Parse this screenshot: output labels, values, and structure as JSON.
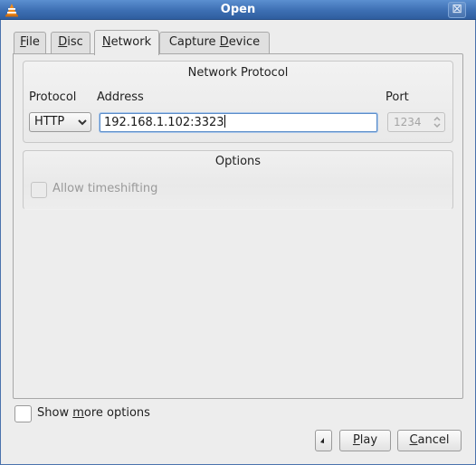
{
  "window": {
    "title": "Open",
    "close_glyph": "⊠"
  },
  "tabs": [
    {
      "pre": "",
      "mn": "F",
      "post": "ile"
    },
    {
      "pre": "",
      "mn": "D",
      "post": "isc"
    },
    {
      "pre": "",
      "mn": "N",
      "post": "etwork"
    },
    {
      "pre": "Capture ",
      "mn": "D",
      "post": "evice"
    }
  ],
  "network": {
    "heading": "Network Protocol",
    "protocol_label": "Protocol",
    "address_label": "Address",
    "port_label": "Port",
    "protocol_value": "HTTP",
    "address_value": "192.168.1.102:3323",
    "port_value": "1234"
  },
  "options": {
    "heading": "Options",
    "timeshift_label": "Allow timeshifting"
  },
  "footer": {
    "more_pre": "Show ",
    "more_mn": "m",
    "more_post": "ore options",
    "play_mn": "P",
    "play_post": "lay",
    "cancel_mn": "C",
    "cancel_post": "ancel"
  },
  "icons": {
    "app": "vlc-cone-icon",
    "caret": "chevron-down-icon",
    "spin": "spin-arrows-icon"
  },
  "colors": {
    "titlebar": "#3d6fb3",
    "vlc_orange": "#f08a1c",
    "focus_blue": "#5b8dc9"
  }
}
